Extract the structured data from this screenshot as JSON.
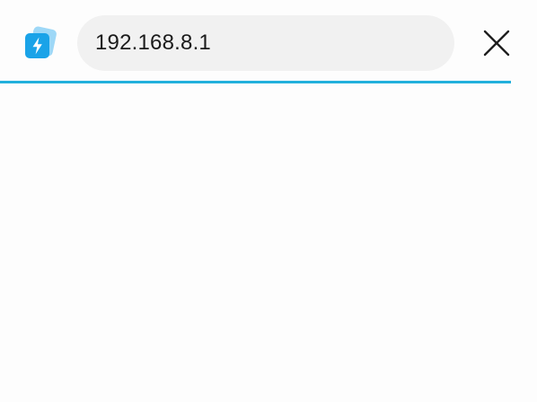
{
  "address_bar": {
    "value": "192.168.8.1"
  },
  "app": {
    "icon": "lightning-bolt-icon",
    "accent_color": "#1aa3e8"
  },
  "controls": {
    "close_icon": "close-icon"
  },
  "page_load": {
    "progress": 1.0,
    "color": "#22b0dc"
  }
}
